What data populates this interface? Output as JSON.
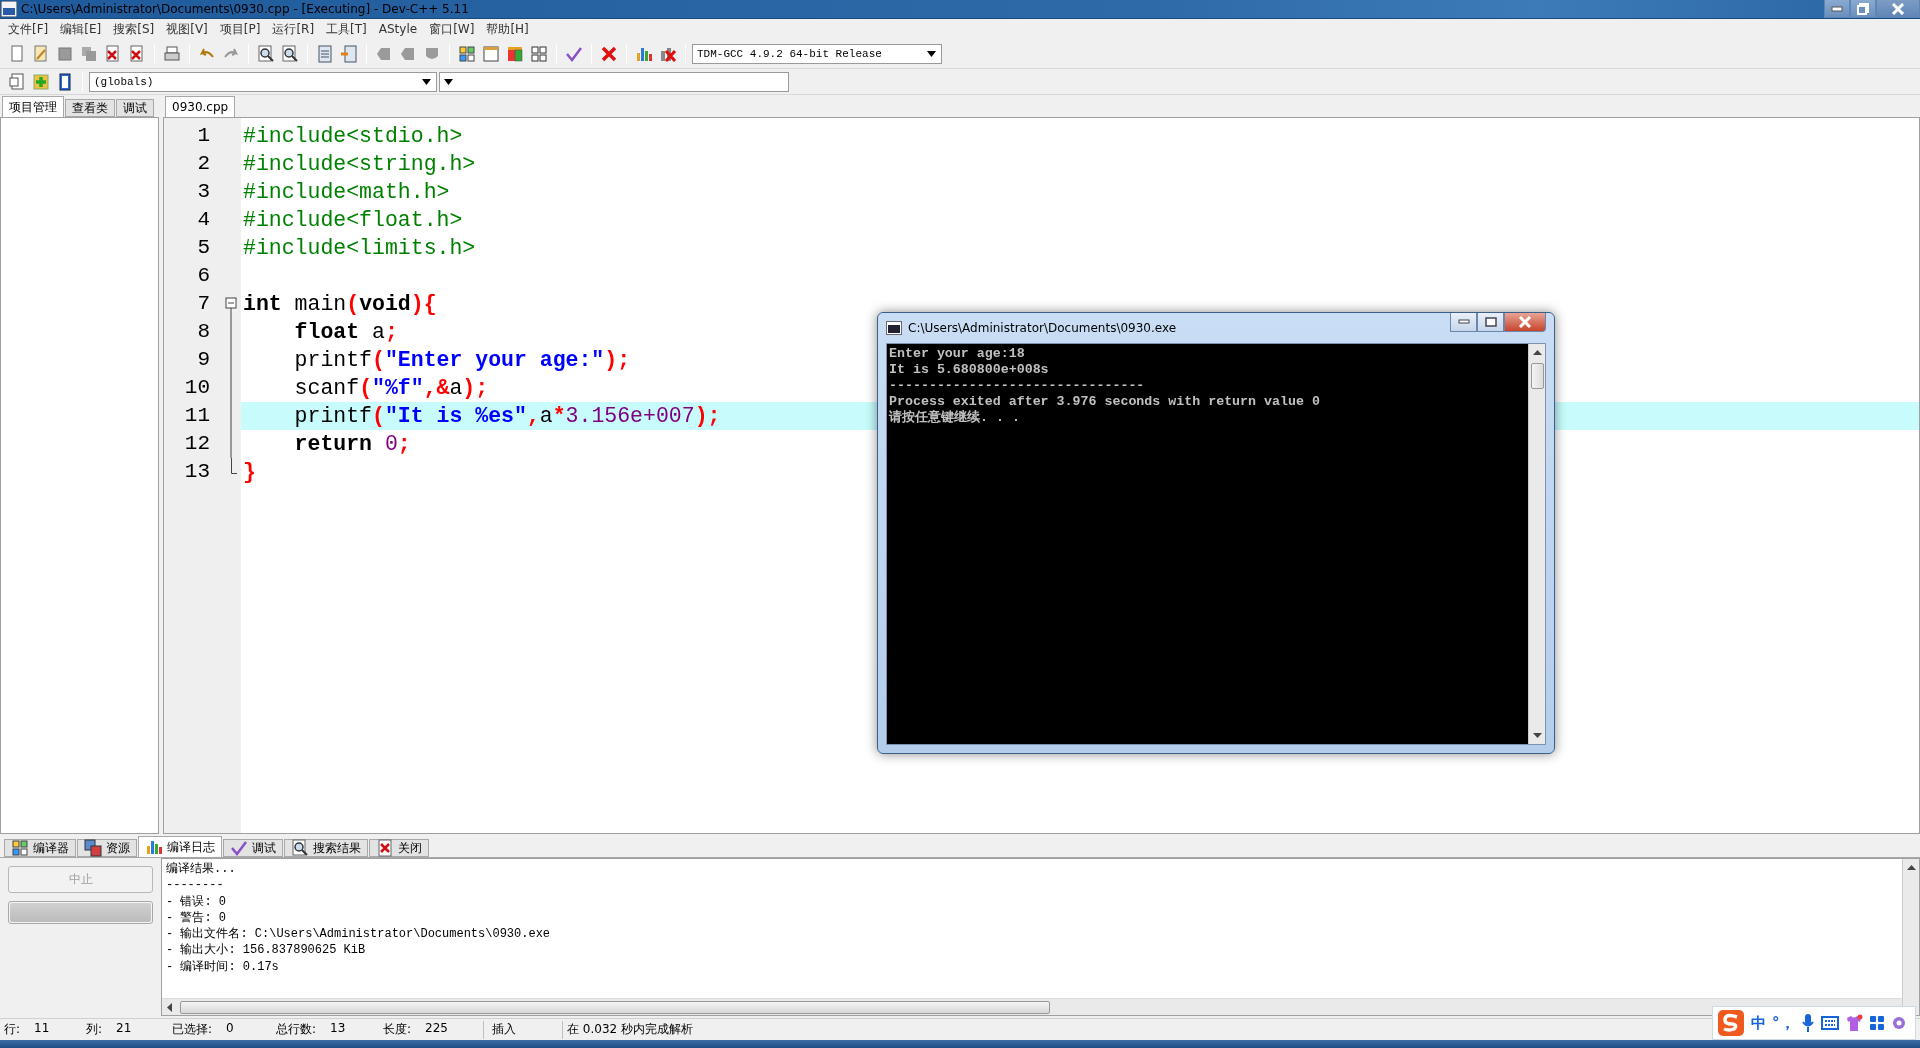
{
  "window": {
    "title": "C:\\Users\\Administrator\\Documents\\0930.cpp - [Executing] - Dev-C++ 5.11"
  },
  "menu": [
    "文件[F]",
    "编辑[E]",
    "搜索[S]",
    "视图[V]",
    "项目[P]",
    "运行[R]",
    "工具[T]",
    "AStyle",
    "窗口[W]",
    "帮助[H]"
  ],
  "toolbar": {
    "compiler": "TDM-GCC 4.9.2 64-bit Release",
    "scope": "(globals)"
  },
  "side_tabs": [
    {
      "label": "项目管理",
      "selected": true
    },
    {
      "label": "查看类",
      "selected": false
    },
    {
      "label": "调试",
      "selected": false
    }
  ],
  "editor": {
    "tabs": [
      {
        "label": "0930.cpp",
        "selected": true
      }
    ],
    "lines": [
      {
        "number": "1",
        "highlighted": false,
        "tokens": [
          {
            "kind": "pre",
            "text": "#include<stdio.h>"
          }
        ]
      },
      {
        "number": "2",
        "highlighted": false,
        "tokens": [
          {
            "kind": "pre",
            "text": "#include<string.h>"
          }
        ]
      },
      {
        "number": "3",
        "highlighted": false,
        "tokens": [
          {
            "kind": "pre",
            "text": "#include<math.h>"
          }
        ]
      },
      {
        "number": "4",
        "highlighted": false,
        "tokens": [
          {
            "kind": "pre",
            "text": "#include<float.h>"
          }
        ]
      },
      {
        "number": "5",
        "highlighted": false,
        "tokens": [
          {
            "kind": "pre",
            "text": "#include<limits.h>"
          }
        ]
      },
      {
        "number": "6",
        "highlighted": false
      },
      {
        "number": "7",
        "highlighted": false,
        "fold": {
          "kind": "start"
        },
        "tokens": [
          {
            "kind": "kw",
            "text": "int"
          },
          {
            "kind": "plain",
            "text": " main"
          },
          {
            "kind": "punc",
            "text": "("
          },
          {
            "kind": "kw",
            "text": "void"
          },
          {
            "kind": "punc",
            "text": "){"
          }
        ]
      },
      {
        "number": "8",
        "highlighted": false,
        "fold": {
          "kind": "body"
        },
        "tokens": [
          {
            "kind": "kw",
            "text": "    float"
          },
          {
            "kind": "plain",
            "text": " a"
          },
          {
            "kind": "punc",
            "text": ";"
          }
        ]
      },
      {
        "number": "9",
        "highlighted": false,
        "fold": {
          "kind": "body"
        },
        "tokens": [
          {
            "kind": "plain",
            "text": "    printf"
          },
          {
            "kind": "punc",
            "text": "("
          },
          {
            "kind": "str",
            "text": "\"Enter your age:\""
          },
          {
            "kind": "punc",
            "text": ");"
          }
        ]
      },
      {
        "number": "10",
        "highlighted": false,
        "fold": {
          "kind": "body"
        },
        "tokens": [
          {
            "kind": "plain",
            "text": "    scanf"
          },
          {
            "kind": "punc",
            "text": "("
          },
          {
            "kind": "str",
            "text": "\"%f\""
          },
          {
            "kind": "punc",
            "text": ",&"
          },
          {
            "kind": "plain",
            "text": "a"
          },
          {
            "kind": "punc",
            "text": ");"
          }
        ]
      },
      {
        "number": "11",
        "highlighted": true,
        "fold": {
          "kind": "body"
        },
        "tokens": [
          {
            "kind": "plain",
            "text": "    printf"
          },
          {
            "kind": "punc",
            "text": "("
          },
          {
            "kind": "str",
            "text": "\"It is %es\""
          },
          {
            "kind": "punc",
            "text": ","
          },
          {
            "kind": "plain",
            "text": "a"
          },
          {
            "kind": "punc",
            "text": "*"
          },
          {
            "kind": "num",
            "text": "3.156e+007"
          },
          {
            "kind": "punc",
            "text": ");"
          }
        ]
      },
      {
        "number": "12",
        "highlighted": false,
        "fold": {
          "kind": "body"
        },
        "tokens": [
          {
            "kind": "kw",
            "text": "    return"
          },
          {
            "kind": "num",
            "text": " 0"
          },
          {
            "kind": "punc",
            "text": ";"
          }
        ]
      },
      {
        "number": "13",
        "highlighted": false,
        "fold": {
          "kind": "end"
        },
        "tokens": [
          {
            "kind": "punc",
            "text": "}"
          }
        ]
      }
    ]
  },
  "console": {
    "title": "C:\\Users\\Administrator\\Documents\\0930.exe",
    "lines": [
      "Enter your age:18",
      "It is 5.680800e+008s",
      "--------------------------------",
      "Process exited after 3.976 seconds with return value 0",
      "请按任意键继续. . ."
    ]
  },
  "bottom": {
    "tabs": [
      {
        "label": "编译器",
        "selected": false
      },
      {
        "label": "资源",
        "selected": false
      },
      {
        "label": "编译日志",
        "selected": true
      },
      {
        "label": "调试",
        "selected": false
      },
      {
        "label": "搜索结果",
        "selected": false
      },
      {
        "label": "关闭",
        "selected": false
      }
    ],
    "abort_button": {
      "label": "中止",
      "disabled": true
    },
    "progress": {
      "level": 1
    },
    "log": [
      "编译结果...",
      "--------",
      "- 错误: 0",
      "- 警告: 0",
      "- 输出文件名: C:\\Users\\Administrator\\Documents\\0930.exe",
      "- 输出大小: 156.837890625 KiB",
      "- 编译时间: 0.17s"
    ]
  },
  "status_bar": {
    "fields": [
      {
        "label": "行:",
        "value": "11"
      },
      {
        "label": "列:",
        "value": "21"
      },
      {
        "label": "已选择:",
        "value": "0"
      },
      {
        "label": "总行数:",
        "value": "13"
      },
      {
        "label": "长度:",
        "value": "225"
      }
    ],
    "mode": "插入",
    "message": "在 0.032 秒内完成解析"
  },
  "ime": {
    "mode": "中",
    "punct": "°，"
  }
}
